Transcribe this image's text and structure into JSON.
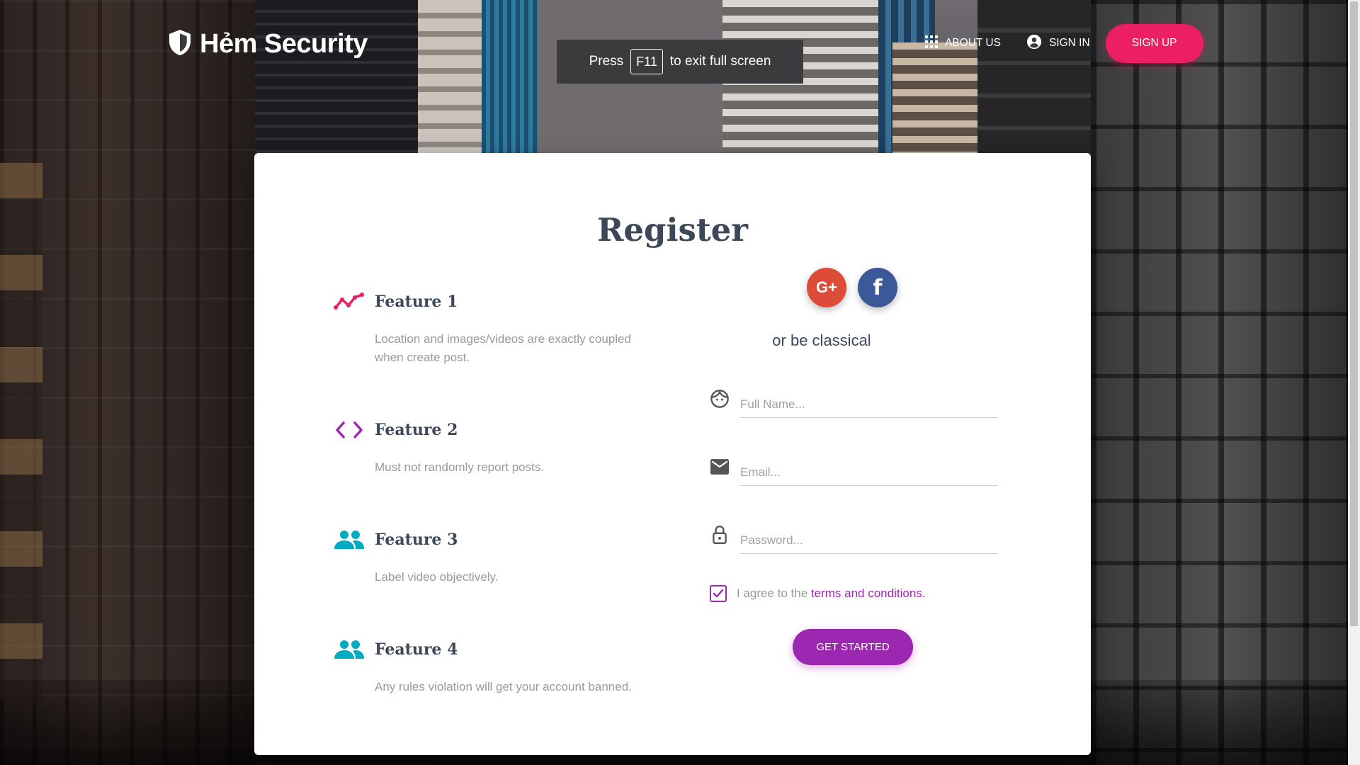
{
  "brand": {
    "name": "Hẻm Security",
    "icon": "shield-icon"
  },
  "nav": {
    "about_label": "ABOUT US",
    "signin_label": "SIGN IN",
    "signup_label": "SIGN UP"
  },
  "toast": {
    "prefix": "Press",
    "key": "F11",
    "suffix": "to exit full screen"
  },
  "card": {
    "title": "Register",
    "features": [
      {
        "title": "Feature 1",
        "desc": "Location and images/videos are exactly coupled when create post.",
        "icon": "trending-icon",
        "color": "#e91e63"
      },
      {
        "title": "Feature 2",
        "desc": "Must not randomly report posts.",
        "icon": "code-icon",
        "color": "#9c27b0"
      },
      {
        "title": "Feature 3",
        "desc": "Label video objectively.",
        "icon": "group-icon",
        "color": "#00acc1"
      },
      {
        "title": "Feature 4",
        "desc": "Any rules violation will get your account banned.",
        "icon": "group-icon",
        "color": "#00acc1"
      }
    ],
    "social": {
      "google_label": "G+",
      "facebook_label": "f"
    },
    "classical_text": "or be classical",
    "form": {
      "fullname_placeholder": "Full Name...",
      "email_placeholder": "Email...",
      "password_placeholder": "Password...",
      "agree_text": "I agree to the",
      "terms_text": "terms and conditions",
      "terms_suffix": ".",
      "agree_checked": true,
      "submit_label": "GET STARTED"
    }
  },
  "colors": {
    "primary": "#9c27b0",
    "signup": "#ec1f63",
    "title": "#3c4858"
  }
}
